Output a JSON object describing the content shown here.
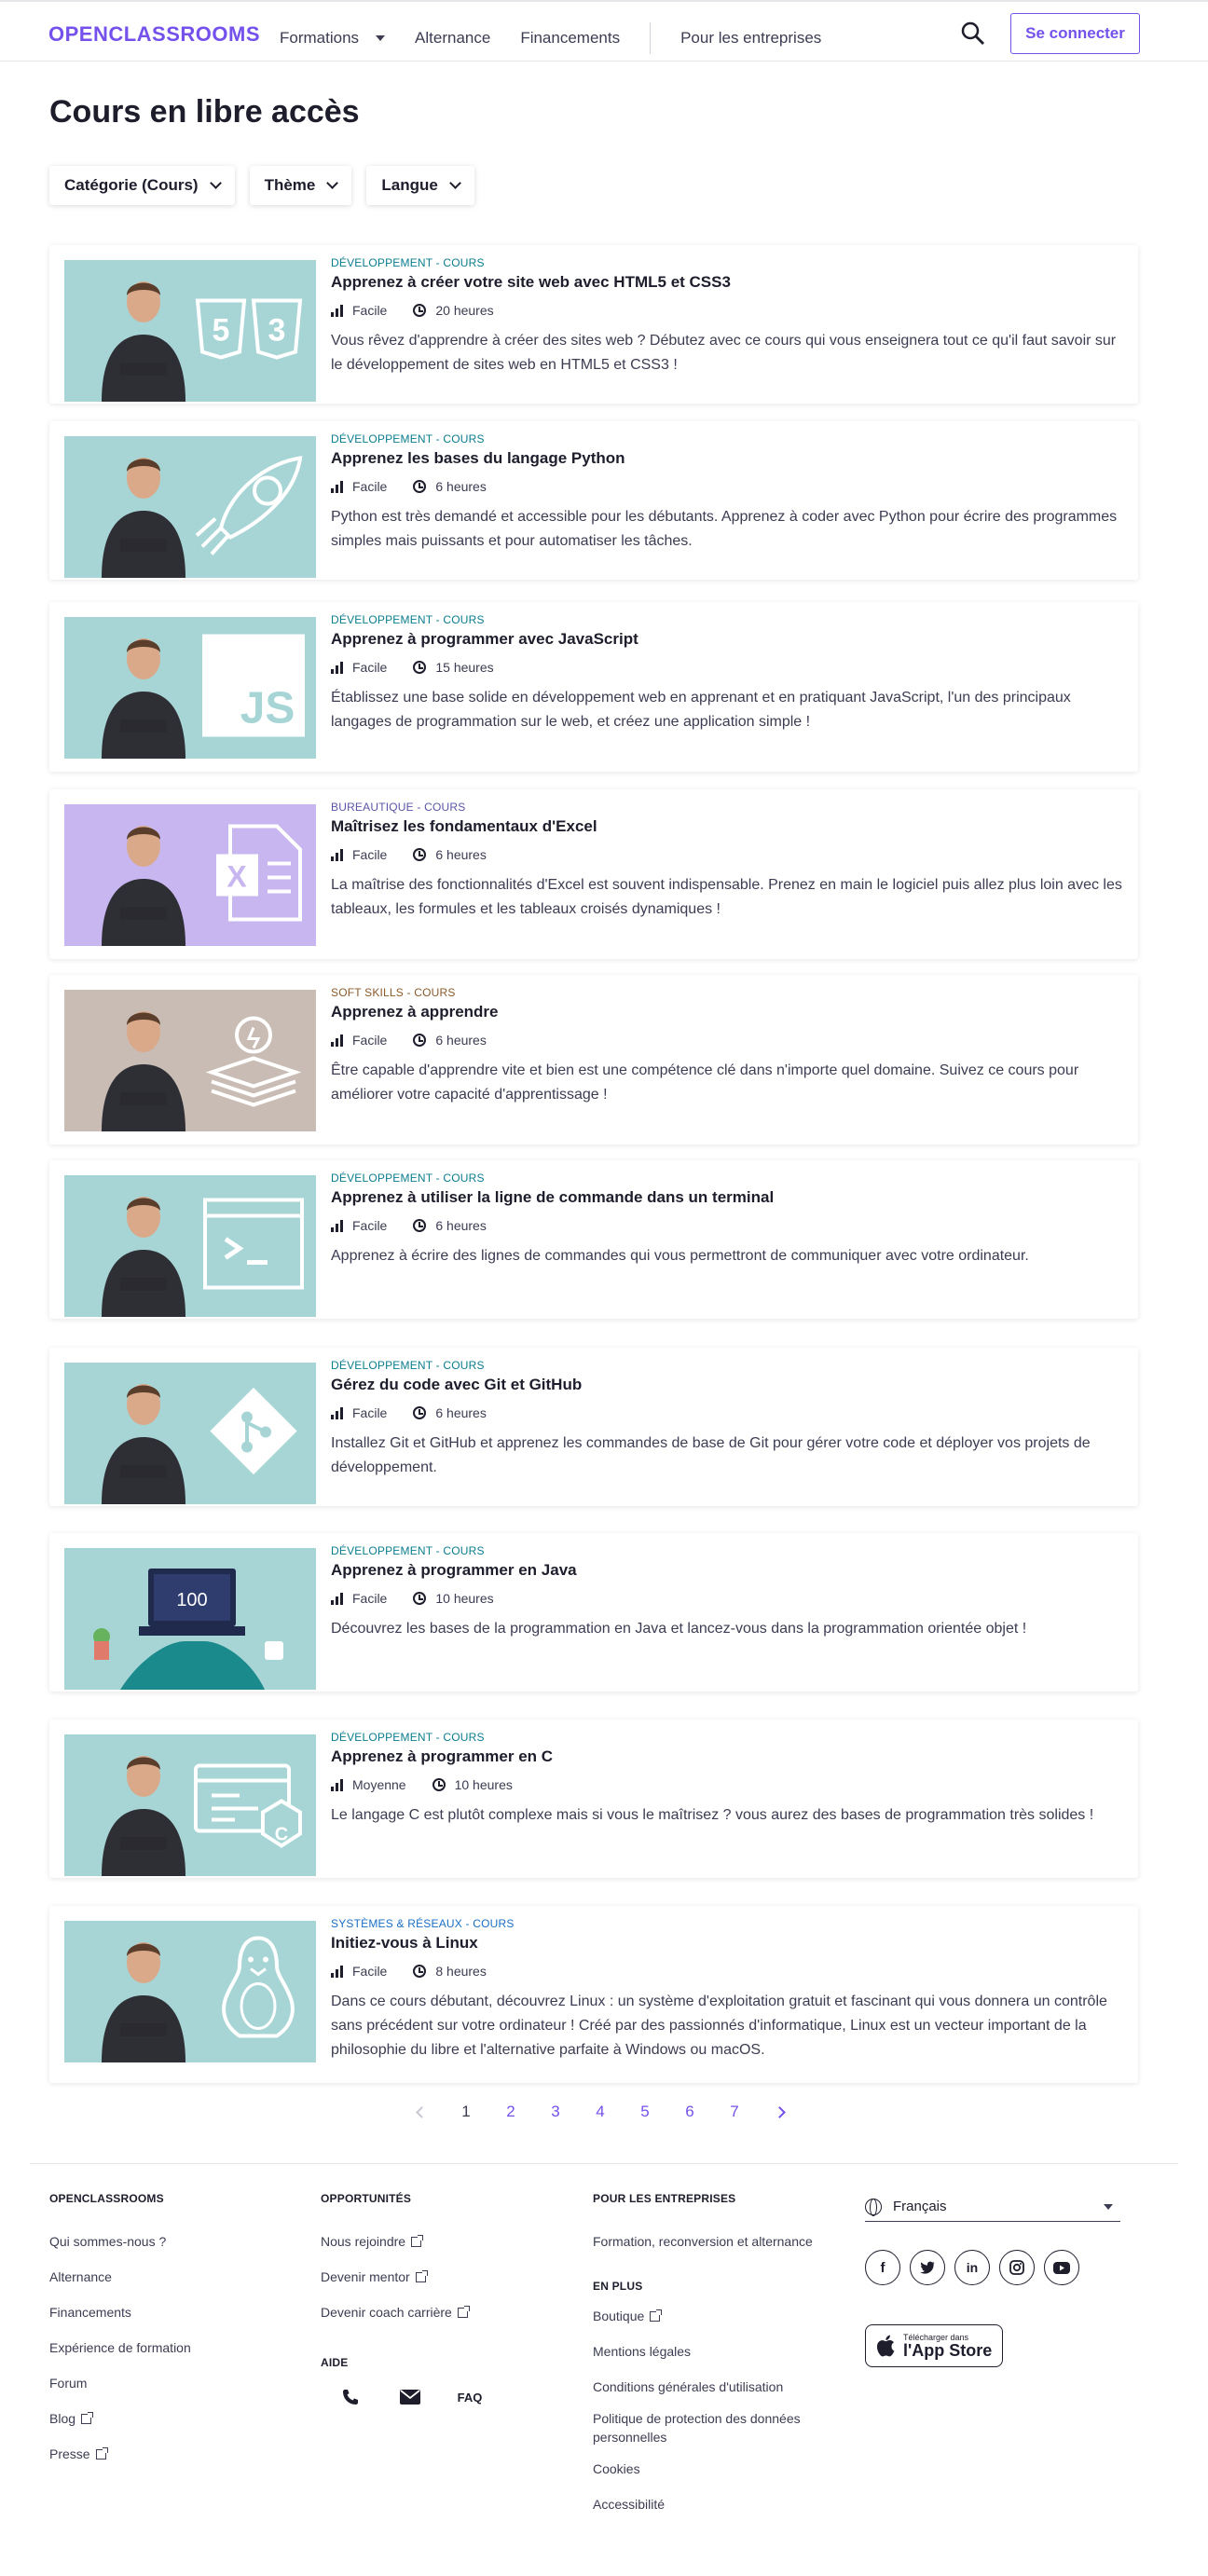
{
  "header": {
    "logo": "OPENCLASSROOMS",
    "nav": [
      "Formations",
      "Alternance",
      "Financements"
    ],
    "nav_business": "Pour les entreprises",
    "login": "Se connecter"
  },
  "page_title": "Cours en libre accès",
  "filters": [
    "Catégorie (Cours)",
    "Thème",
    "Langue"
  ],
  "colors": {
    "accent": "#7451eb",
    "dev_category": "#0a7d8f",
    "office_category": "#5b55a8",
    "softskills_category": "#8a5a2b",
    "sysnet_category": "#1a6fc4",
    "thumb_teal": "#a7d5d6",
    "thumb_purple": "#c8b6f0",
    "thumb_taupe": "#c9bcb4"
  },
  "courses": [
    {
      "category": "Développement - Cours",
      "title": "Apprenez à créer votre site web avec HTML5 et CSS3",
      "level": "Facile",
      "duration": "20 heures",
      "description": "Vous rêvez d'apprendre à créer des sites web ? Débutez avec ce cours qui vous enseignera tout ce qu'il faut savoir sur le développement de sites web en HTML5 et CSS3 !",
      "icon": "html5-css3-icon"
    },
    {
      "category": "Développement - Cours",
      "title": "Apprenez les bases du langage Python",
      "level": "Facile",
      "duration": "6 heures",
      "description": "Python est très demandé et accessible pour les débutants. Apprenez à coder avec Python pour écrire des programmes simples mais puissants et pour automatiser les tâches.",
      "icon": "python-rocket-icon"
    },
    {
      "category": "Développement - Cours",
      "title": "Apprenez à programmer avec JavaScript",
      "level": "Facile",
      "duration": "15 heures",
      "description": "Établissez une base solide en développement web en apprenant et en pratiquant JavaScript, l'un des principaux langages de programmation sur le web, et créez une application simple !",
      "icon": "javascript-icon"
    },
    {
      "category": "Bureautique - Cours",
      "title": "Maîtrisez les fondamentaux d'Excel",
      "level": "Facile",
      "duration": "6 heures",
      "description": "La maîtrise des fonctionnalités d'Excel est souvent indispensable. Prenez en main le logiciel puis allez plus loin avec les tableaux, les formules et les tableaux croisés dynamiques !",
      "icon": "excel-icon"
    },
    {
      "category": "Soft skills - Cours",
      "title": "Apprenez à apprendre",
      "level": "Facile",
      "duration": "6 heures",
      "description": "Être capable d'apprendre vite et bien est une compétence clé dans n'importe quel domaine. Suivez ce cours pour améliorer votre capacité d'apprentissage !",
      "icon": "lightbulb-books-icon"
    },
    {
      "category": "Développement - Cours",
      "title": "Apprenez à utiliser la ligne de commande dans un terminal",
      "level": "Facile",
      "duration": "6 heures",
      "description": "Apprenez à écrire des lignes de commandes qui vous permettront de communiquer avec votre ordinateur.",
      "icon": "terminal-icon"
    },
    {
      "category": "Développement - Cours",
      "title": "Gérez du code avec Git et GitHub",
      "level": "Facile",
      "duration": "6 heures",
      "description": "Installez Git et GitHub et apprenez les commandes de base de Git pour gérer votre code et déployer vos projets de développement.",
      "icon": "git-icon"
    },
    {
      "category": "Développement - Cours",
      "title": "Apprenez à programmer en Java",
      "level": "Facile",
      "duration": "10 heures",
      "description": "Découvrez les bases de la programmation en Java et lancez-vous dans la programmation orientée objet !",
      "icon": "laptop-icon",
      "thumb_text": "100"
    },
    {
      "category": "Développement - Cours",
      "title": "Apprenez à programmer en C",
      "level": "Moyenne",
      "duration": "10 heures",
      "description": "Le langage C est plutôt complexe mais si vous le maîtrisez ? vous aurez des bases de programmation très solides !",
      "icon": "c-language-icon"
    },
    {
      "category": "Systèmes & Réseaux - Cours",
      "title": "Initiez-vous à Linux",
      "level": "Facile",
      "duration": "8 heures",
      "description": "Dans ce cours débutant, découvrez Linux : un système d'exploitation gratuit et fascinant qui vous donnera un contrôle sans précédent sur votre ordinateur ! Créé par des passionnés d'informatique, Linux est un vecteur important de la philosophie du libre et l'alternative parfaite à Windows ou macOS.",
      "icon": "linux-penguin-icon"
    }
  ],
  "pagination": {
    "pages": [
      "1",
      "2",
      "3",
      "4",
      "5",
      "6",
      "7"
    ],
    "current": "1"
  },
  "footer": {
    "col1": {
      "title": "OpenClassrooms",
      "links": [
        "Qui sommes-nous ?",
        "Alternance",
        "Financements",
        "Expérience de formation",
        "Forum",
        "Blog",
        "Presse"
      ]
    },
    "col2": {
      "title": "Opportunités",
      "links": [
        "Nous rejoindre",
        "Devenir mentor",
        "Devenir coach carrière"
      ],
      "aide_title": "Aide",
      "faq": "FAQ"
    },
    "col3": {
      "title": "Pour les entreprises",
      "links": [
        "Formation, reconversion et alternance"
      ],
      "more_title": "En plus",
      "more_links": [
        "Boutique",
        "Mentions légales",
        "Conditions générales d'utilisation",
        "Politique de protection des données personnelles",
        "Cookies",
        "Accessibilité"
      ]
    },
    "language": "Français",
    "social": [
      "facebook-icon",
      "twitter-icon",
      "linkedin-icon",
      "instagram-icon",
      "youtube-icon"
    ],
    "appstore_small": "Télécharger dans",
    "appstore_big": "l'App Store"
  }
}
